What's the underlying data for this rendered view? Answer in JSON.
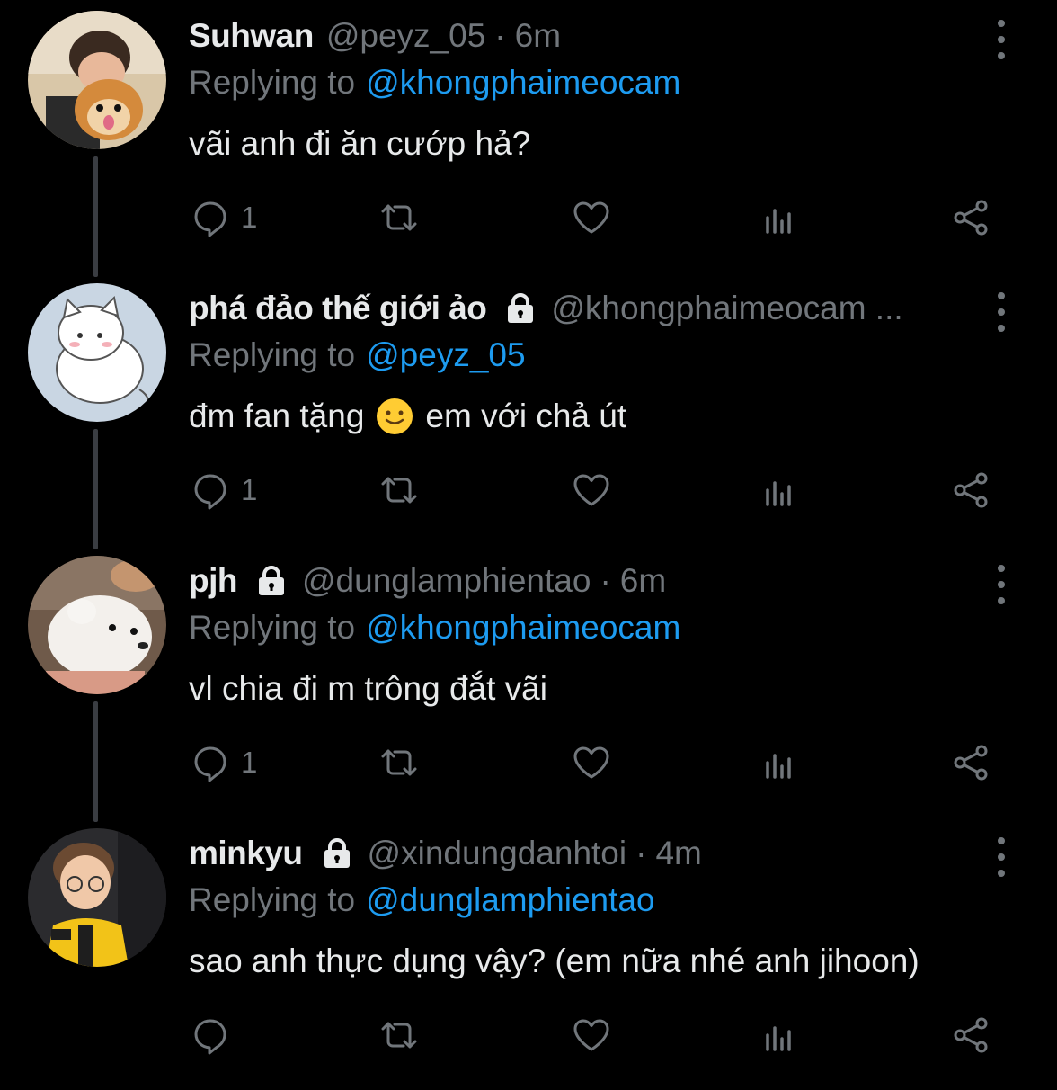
{
  "colors": {
    "background": "#000000",
    "text_primary": "#e7e9ea",
    "text_secondary": "#71767b",
    "link": "#1d9bf0",
    "thread_line": "#3a3d42"
  },
  "tweets": [
    {
      "avatar": "avatar-boy-with-pomeranian",
      "name": "Suhwan",
      "locked": false,
      "handle": "@peyz_05",
      "separator": "·",
      "time": "6m",
      "reply_prefix": "Replying to",
      "reply_to": "@khongphaimeocam",
      "text_before": "vãi anh đi ăn cướp hả?",
      "emoji": "",
      "text_after": "",
      "reply_count": "1",
      "thread_continues": true
    },
    {
      "avatar": "avatar-cartoon-cat",
      "name": "phá đảo thế giới ảo",
      "locked": true,
      "handle": "@khongphaimeocam ...",
      "separator": "",
      "time": "",
      "reply_prefix": "Replying to",
      "reply_to": "@peyz_05",
      "text_before": "đm fan tặng",
      "emoji": "slightly-smiling-face",
      "text_after": "em với chả út",
      "reply_count": "1",
      "thread_continues": true
    },
    {
      "avatar": "avatar-white-dog",
      "name": "pjh",
      "locked": true,
      "handle": "@dunglamphientao",
      "separator": "·",
      "time": "6m",
      "reply_prefix": "Replying to",
      "reply_to": "@khongphaimeocam",
      "text_before": "vl chia đi m trông đắt vãi",
      "emoji": "",
      "text_after": "",
      "reply_count": "1",
      "thread_continues": true
    },
    {
      "avatar": "avatar-gamer-boy",
      "name": "minkyu",
      "locked": true,
      "handle": "@xindungdanhtoi",
      "separator": "·",
      "time": "4m",
      "reply_prefix": "Replying to",
      "reply_to": "@dunglamphientao",
      "text_before": "sao anh thực dụng vậy? (em nữa nhé anh jihoon)",
      "emoji": "",
      "text_after": "",
      "reply_count": "",
      "thread_continues": false
    }
  ],
  "action_icons": [
    "reply-icon",
    "retweet-icon",
    "like-icon",
    "views-icon",
    "share-icon"
  ]
}
